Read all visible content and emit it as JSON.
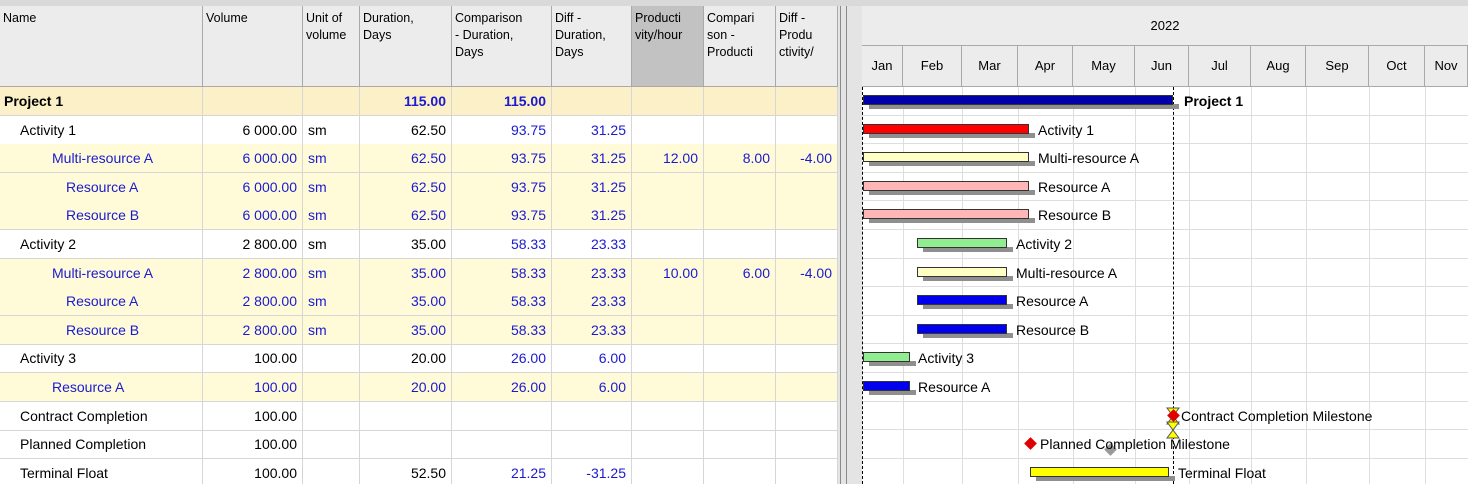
{
  "columns": [
    {
      "key": "name",
      "label": "Name"
    },
    {
      "key": "volume",
      "label": "Volume"
    },
    {
      "key": "unit",
      "label": "Unit of\nvolume"
    },
    {
      "key": "duration",
      "label": "Duration,\nDays"
    },
    {
      "key": "cmp_duration",
      "label": "Comparison\n- Duration,\nDays"
    },
    {
      "key": "diff_duration",
      "label": "Diff -\nDuration,\nDays"
    },
    {
      "key": "productivity",
      "label": "Producti\nvity/hour"
    },
    {
      "key": "cmp_productivity",
      "label": "Compari\nson -\nProducti"
    },
    {
      "key": "diff_productivity",
      "label": "Diff -\nProdu\nctivity/"
    }
  ],
  "rows": [
    {
      "type": "project",
      "name": "Project 1",
      "volume": "",
      "unit": "",
      "duration": "115.00",
      "cmp_duration": "115.00",
      "diff_duration": "",
      "productivity": "",
      "cmp_productivity": "",
      "diff_productivity": ""
    },
    {
      "type": "activity",
      "name": "Activity 1",
      "volume": "6 000.00",
      "unit": "sm",
      "duration": "62.50",
      "cmp_duration": "93.75",
      "diff_duration": "31.25",
      "productivity": "",
      "cmp_productivity": "",
      "diff_productivity": ""
    },
    {
      "type": "multi",
      "name": "Multi-resource A",
      "volume": "6 000.00",
      "unit": "sm",
      "duration": "62.50",
      "cmp_duration": "93.75",
      "diff_duration": "31.25",
      "productivity": "12.00",
      "cmp_productivity": "8.00",
      "diff_productivity": "-4.00"
    },
    {
      "type": "res",
      "name": "Resource A",
      "volume": "6 000.00",
      "unit": "sm",
      "duration": "62.50",
      "cmp_duration": "93.75",
      "diff_duration": "31.25",
      "productivity": "",
      "cmp_productivity": "",
      "diff_productivity": ""
    },
    {
      "type": "res",
      "name": "Resource B",
      "volume": "6 000.00",
      "unit": "sm",
      "duration": "62.50",
      "cmp_duration": "93.75",
      "diff_duration": "31.25",
      "productivity": "",
      "cmp_productivity": "",
      "diff_productivity": ""
    },
    {
      "type": "activity",
      "name": "Activity 2",
      "volume": "2 800.00",
      "unit": "sm",
      "duration": "35.00",
      "cmp_duration": "58.33",
      "diff_duration": "23.33",
      "productivity": "",
      "cmp_productivity": "",
      "diff_productivity": ""
    },
    {
      "type": "multi",
      "name": "Multi-resource A",
      "volume": "2 800.00",
      "unit": "sm",
      "duration": "35.00",
      "cmp_duration": "58.33",
      "diff_duration": "23.33",
      "productivity": "10.00",
      "cmp_productivity": "6.00",
      "diff_productivity": "-4.00"
    },
    {
      "type": "res",
      "name": "Resource A",
      "volume": "2 800.00",
      "unit": "sm",
      "duration": "35.00",
      "cmp_duration": "58.33",
      "diff_duration": "23.33",
      "productivity": "",
      "cmp_productivity": "",
      "diff_productivity": ""
    },
    {
      "type": "res",
      "name": "Resource B",
      "volume": "2 800.00",
      "unit": "sm",
      "duration": "35.00",
      "cmp_duration": "58.33",
      "diff_duration": "23.33",
      "productivity": "",
      "cmp_productivity": "",
      "diff_productivity": ""
    },
    {
      "type": "activity",
      "name": "Activity 3",
      "volume": "100.00",
      "unit": "",
      "duration": "20.00",
      "cmp_duration": "26.00",
      "diff_duration": "6.00",
      "productivity": "",
      "cmp_productivity": "",
      "diff_productivity": ""
    },
    {
      "type": "multi",
      "name": "Resource A",
      "volume": "100.00",
      "unit": "",
      "duration": "20.00",
      "cmp_duration": "26.00",
      "diff_duration": "6.00",
      "productivity": "",
      "cmp_productivity": "",
      "diff_productivity": ""
    },
    {
      "type": "activity",
      "name": "Contract Completion",
      "volume": "100.00",
      "unit": "",
      "duration": "",
      "cmp_duration": "",
      "diff_duration": "",
      "productivity": "",
      "cmp_productivity": "",
      "diff_productivity": ""
    },
    {
      "type": "activity",
      "name": "Planned Completion",
      "volume": "100.00",
      "unit": "",
      "duration": "",
      "cmp_duration": "",
      "diff_duration": "",
      "productivity": "",
      "cmp_productivity": "",
      "diff_productivity": ""
    },
    {
      "type": "activity",
      "name": "Terminal Float",
      "volume": "100.00",
      "unit": "",
      "duration": "52.50",
      "cmp_duration": "21.25",
      "diff_duration": "-31.25",
      "productivity": "",
      "cmp_productivity": "",
      "diff_productivity": ""
    }
  ],
  "gantt": {
    "year": "2022",
    "months": [
      "Jan",
      "Feb",
      "Mar",
      "Apr",
      "May",
      "Jun",
      "Jul",
      "Aug",
      "Sep",
      "Oct",
      "Nov"
    ],
    "colors": {
      "project": "#0000a8",
      "activity1": "#ff0000",
      "multi": "#ffffc4",
      "resource1": "#ffb6b6",
      "activity2": "#90ee90",
      "resource2": "#0000ee",
      "float": "#ffff00",
      "milestone": "#e00000",
      "hourglass": "#ffff00"
    },
    "items": [
      {
        "label": "Project 1",
        "kind": "bar",
        "color": "project"
      },
      {
        "label": "Activity 1",
        "kind": "bar",
        "color": "activity1"
      },
      {
        "label": "Multi-resource A",
        "kind": "bar",
        "color": "multi"
      },
      {
        "label": "Resource A",
        "kind": "bar",
        "color": "resource1"
      },
      {
        "label": "Resource B",
        "kind": "bar",
        "color": "resource1"
      },
      {
        "label": "Activity 2",
        "kind": "bar",
        "color": "activity2"
      },
      {
        "label": "Multi-resource A",
        "kind": "bar",
        "color": "multi"
      },
      {
        "label": "Resource A",
        "kind": "bar",
        "color": "resource2"
      },
      {
        "label": "Resource B",
        "kind": "bar",
        "color": "resource2"
      },
      {
        "label": "Activity 3",
        "kind": "bar",
        "color": "activity2"
      },
      {
        "label": "Resource A",
        "kind": "bar",
        "color": "resource2"
      },
      {
        "label": "Contract Completion Milestone",
        "kind": "milestone-hourglass",
        "color": "milestone"
      },
      {
        "label": "Planned Completion Milestone",
        "kind": "milestone",
        "color": "milestone"
      },
      {
        "label": "Terminal Float",
        "kind": "bar",
        "color": "float"
      }
    ]
  }
}
